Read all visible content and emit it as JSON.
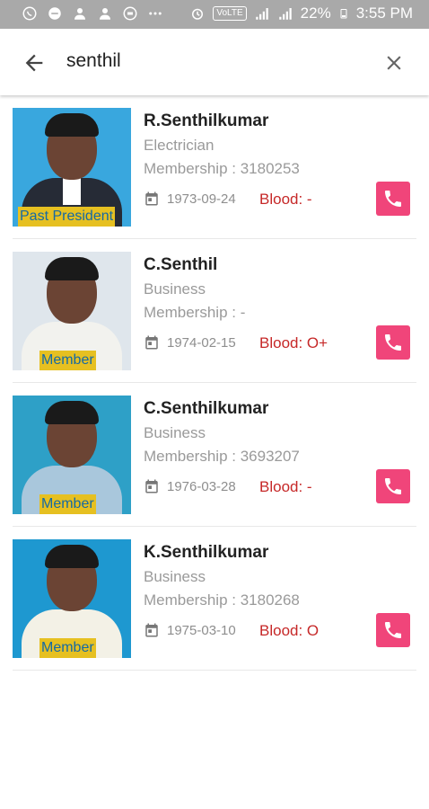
{
  "status_bar": {
    "battery": "22%",
    "time": "3:55 PM",
    "network_badge": "VoLTE"
  },
  "search": {
    "query": "senthil"
  },
  "members": [
    {
      "name": "R.Senthilkumar",
      "profession": "Electrician",
      "membership": "Membership : 3180253",
      "dob": "1973-09-24",
      "blood": "Blood: -",
      "role": "Past President"
    },
    {
      "name": "C.Senthil",
      "profession": "Business",
      "membership": "Membership : -",
      "dob": "1974-02-15",
      "blood": "Blood: O+",
      "role": "Member"
    },
    {
      "name": "C.Senthilkumar",
      "profession": "Business",
      "membership": "Membership : 3693207",
      "dob": "1976-03-28",
      "blood": "Blood: -",
      "role": "Member"
    },
    {
      "name": "K.Senthilkumar",
      "profession": "Business",
      "membership": "Membership : 3180268",
      "dob": "1975-03-10",
      "blood": "Blood: O",
      "role": "Member"
    }
  ],
  "colors": {
    "accent_call": "#f0457a",
    "blood_text": "#c62828",
    "badge_bg": "#e6c021",
    "badge_text": "#1569a4",
    "status_bar": "#a9a9a9"
  },
  "icons": [
    "whatsapp-icon",
    "messenger-icon",
    "person-icon",
    "person-icon",
    "vpn-icon",
    "more-dots-icon",
    "alarm-icon",
    "signal-icon",
    "battery-icon",
    "back-arrow-icon",
    "close-icon",
    "calendar-icon",
    "phone-icon"
  ]
}
